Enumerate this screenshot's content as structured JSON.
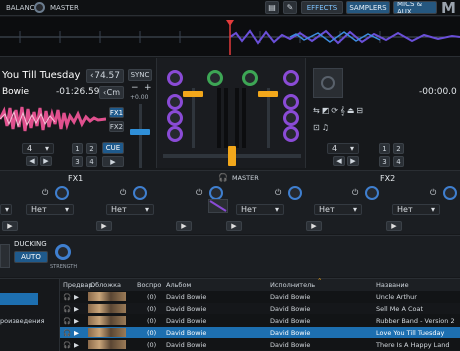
{
  "topbar": {
    "balance_label": "BALANCE",
    "master_label": "MASTER",
    "tabs": [
      {
        "label": "EFFECTS"
      },
      {
        "label": "SAMPLERS"
      },
      {
        "label": "MICS & AUX"
      }
    ],
    "logo": "M"
  },
  "deck_left": {
    "title": "You Till Tuesday",
    "bpm": "74.57",
    "artist": "Bowie",
    "time": "-01:26.59",
    "key": "Cm",
    "sync_label": "SYNC",
    "pitch_value": "+0.00",
    "fx1": "FX1",
    "fx2": "FX2",
    "loop_value": "4",
    "cue_label": "CUE",
    "pads": [
      "1",
      "2",
      "3",
      "4"
    ]
  },
  "deck_right": {
    "time": "-00:00.0",
    "loop_value": "4",
    "pads": [
      "1",
      "2",
      "3",
      "4"
    ]
  },
  "fx": {
    "fx1_title": "FX1",
    "fx2_title": "FX2",
    "master_label": "MASTER",
    "slots": [
      "Нет",
      "Нет",
      "Нет",
      "Нет",
      "Нет",
      "Нет"
    ]
  },
  "ducking": {
    "label": "DUCKING",
    "auto_label": "AUTO",
    "strength_label": "STRENGTH"
  },
  "browser": {
    "columns": {
      "preview": "Предвар.",
      "cover": "Обложка",
      "plays": "Воспро",
      "album": "Альбом",
      "artist": "Исполнитель",
      "title": "Название"
    },
    "sidebar_item": "роизведения",
    "rows": [
      {
        "plays": "(0)",
        "album": "David Bowie",
        "artist": "David Bowie",
        "title": "Uncle Arthur",
        "selected": false
      },
      {
        "plays": "(0)",
        "album": "David Bowie",
        "artist": "David Bowie",
        "title": "Sell Me A Coat",
        "selected": false
      },
      {
        "plays": "(0)",
        "album": "David Bowie",
        "artist": "David Bowie",
        "title": "Rubber Band - Version 2",
        "selected": false
      },
      {
        "plays": "(0)",
        "album": "David Bowie",
        "artist": "David Bowie",
        "title": "Love You Till Tuesday",
        "selected": true
      },
      {
        "plays": "(0)",
        "album": "David Bowie",
        "artist": "David Bowie",
        "title": "There Is A Happy Land",
        "selected": false
      }
    ]
  },
  "colors": {
    "accent": "#2f8fd8",
    "selected_row": "#1d6fb0",
    "cue": "#1f5a8c",
    "warn": "#f2a71b"
  }
}
